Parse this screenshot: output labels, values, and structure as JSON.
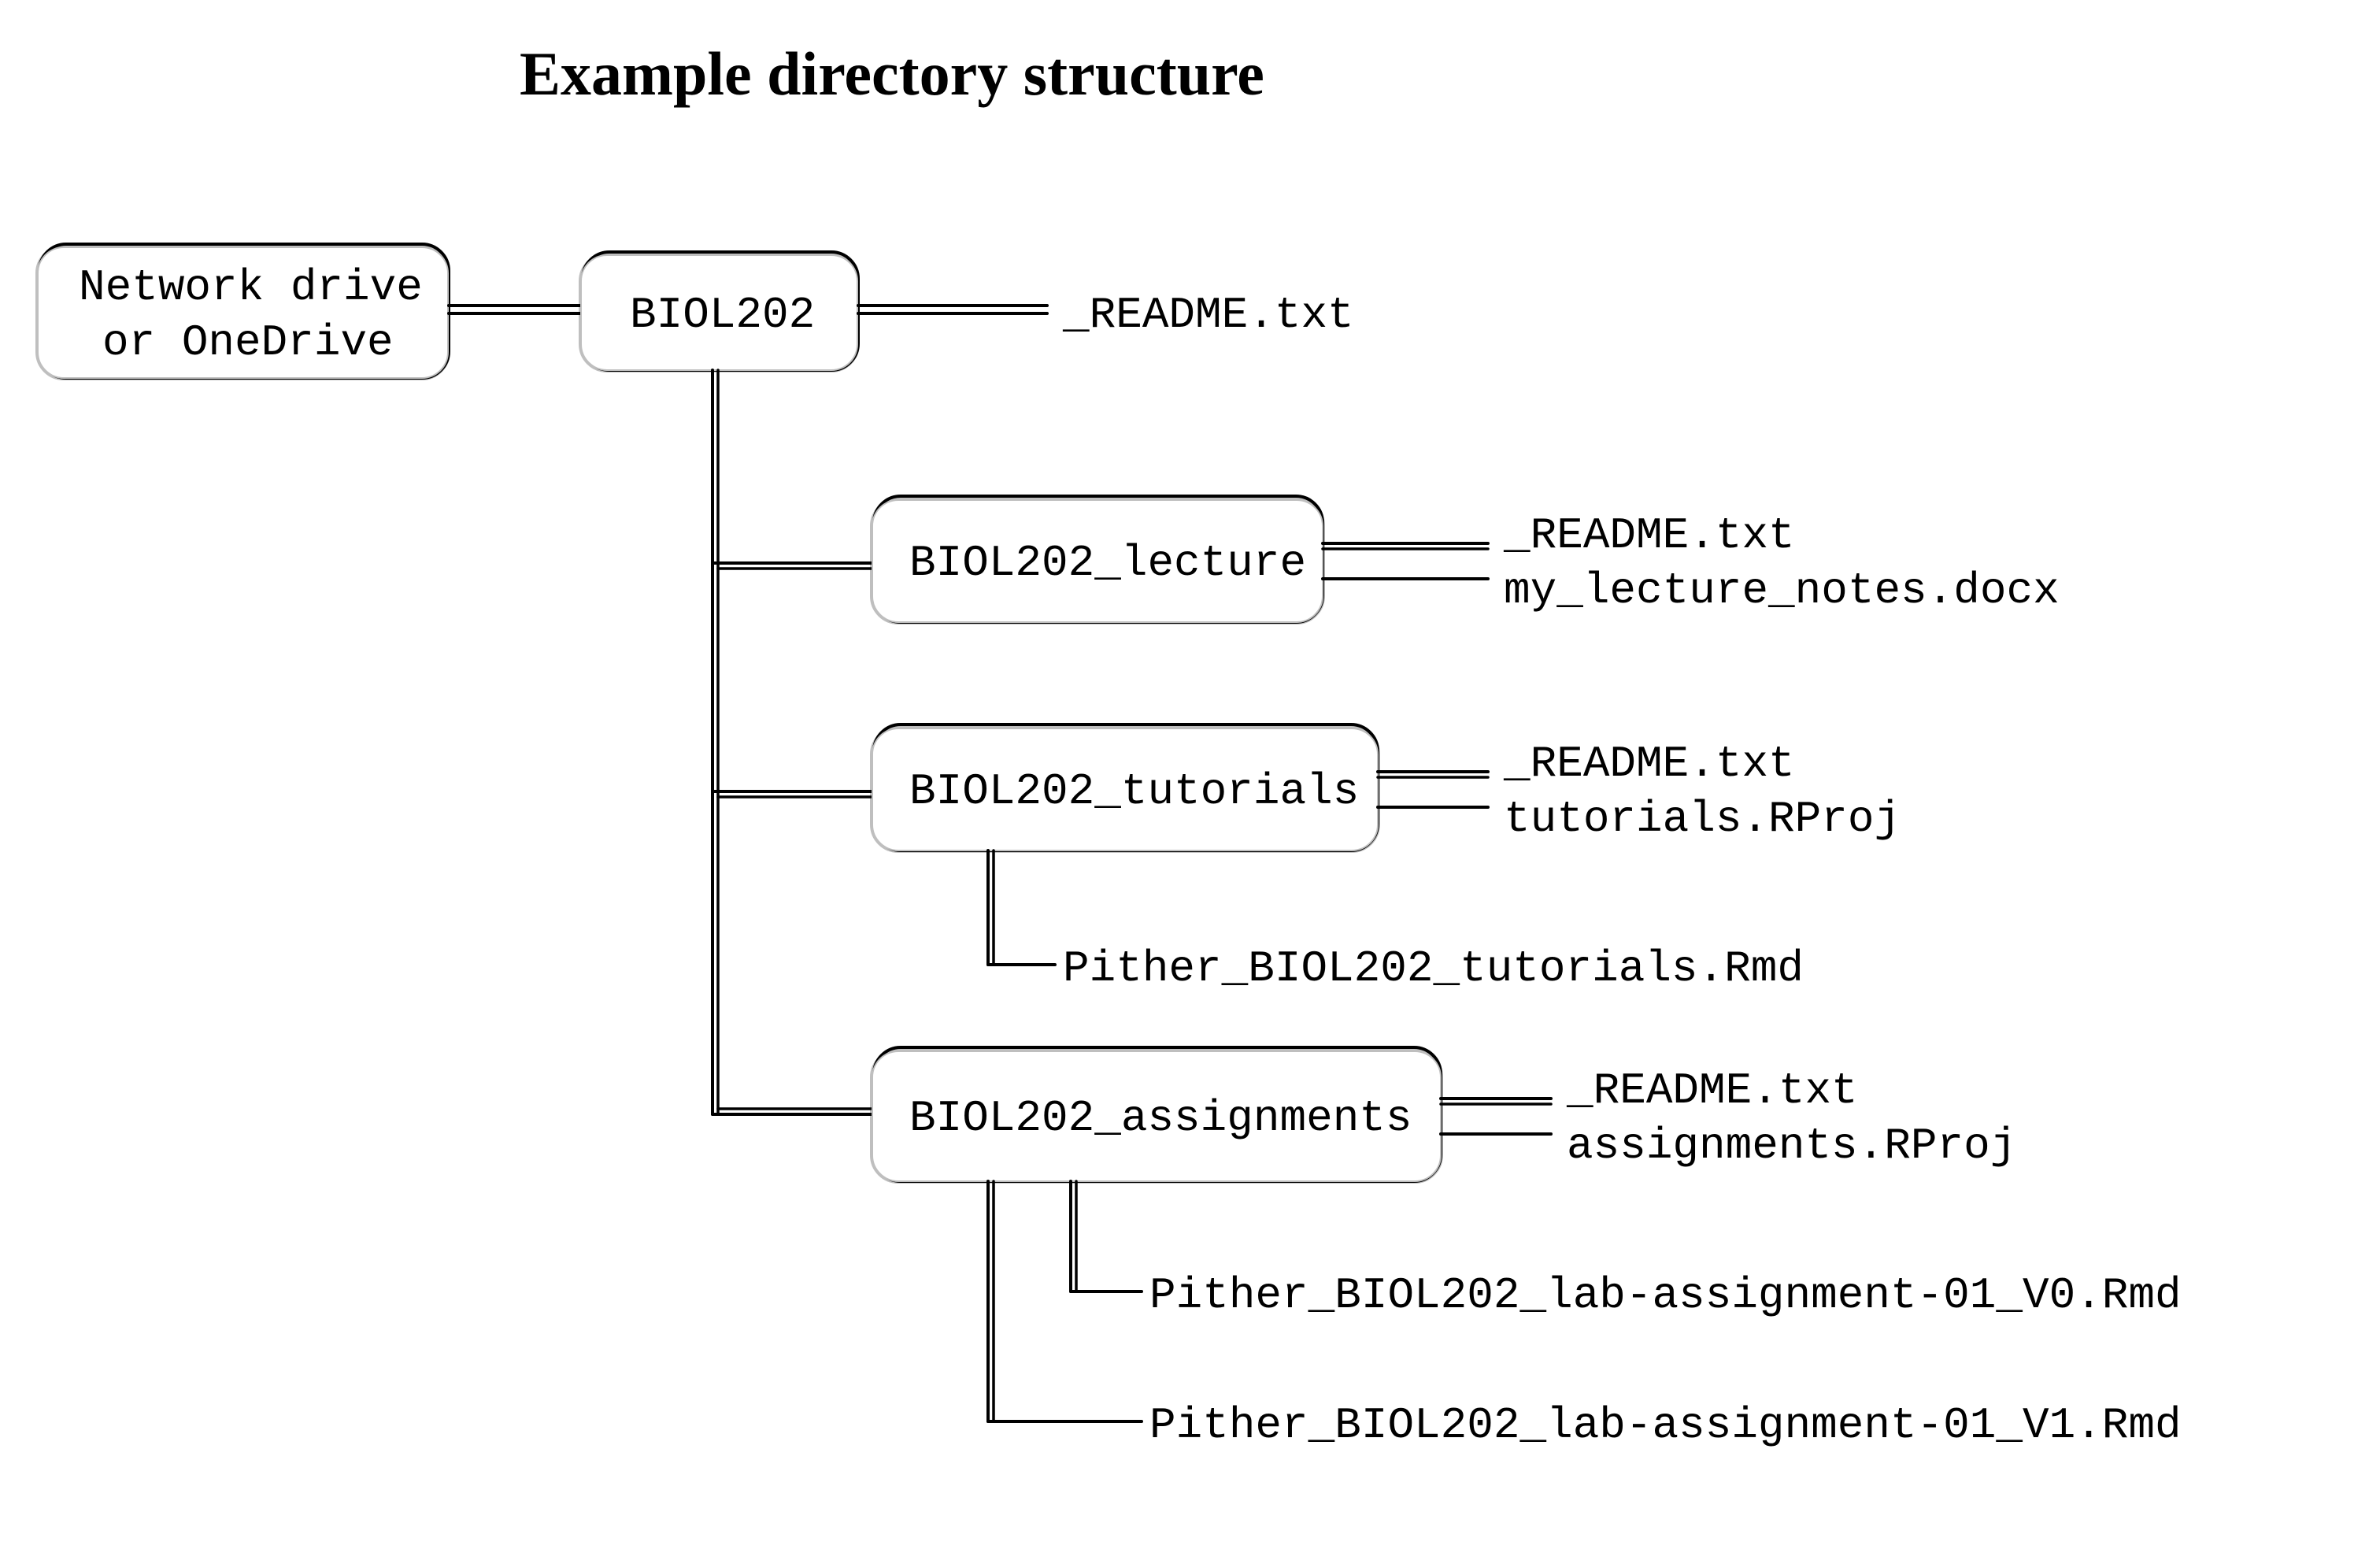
{
  "title": "Example directory structure",
  "root_node": {
    "line1": "Network drive",
    "line2": "or OneDrive"
  },
  "biol_node": "BIOL202",
  "biol_files": {
    "f1": "_README.txt"
  },
  "lecture_node": "BIOL202_lecture",
  "lecture_files": {
    "f1": "_README.txt",
    "f2": "my_lecture_notes.docx"
  },
  "tutorials_node": "BIOL202_tutorials",
  "tutorials_files": {
    "f1": "_README.txt",
    "f2": "tutorials.RProj"
  },
  "tutorials_child": "Pither_BIOL202_tutorials.Rmd",
  "assignments_node": "BIOL202_assignments",
  "assignments_files": {
    "f1": "_README.txt",
    "f2": "assignments.RProj"
  },
  "assignments_child1": "Pither_BIOL202_lab-assignment-01_V0.Rmd",
  "assignments_child2": "Pither_BIOL202_lab-assignment-01_V1.Rmd"
}
